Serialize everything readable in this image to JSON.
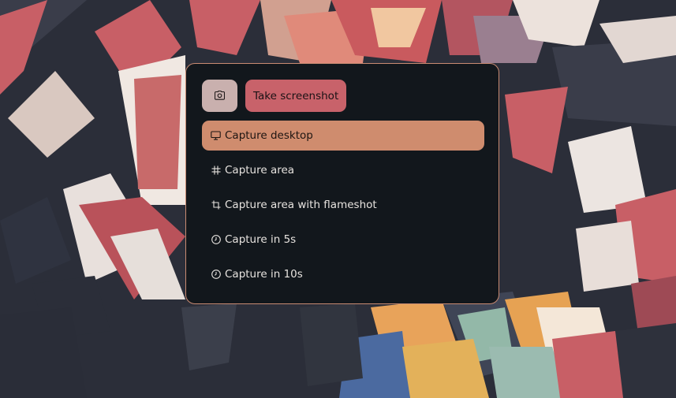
{
  "colors": {
    "panel_bg": "#12171c",
    "panel_border": "#c98b72",
    "camera_button_bg": "#c9b0ae",
    "primary_button_bg": "#c8626a",
    "active_item_bg": "#cf8c6e",
    "text": "#e7e3df"
  },
  "header": {
    "camera_icon": "camera-icon",
    "take_screenshot_label": "Take screenshot"
  },
  "menu": {
    "items": [
      {
        "label": "Capture desktop",
        "icon": "monitor-icon",
        "active": true
      },
      {
        "label": "Capture area",
        "icon": "hash-icon",
        "active": false
      },
      {
        "label": "Capture area with flameshot",
        "icon": "crop-icon",
        "active": false
      },
      {
        "label": "Capture in 5s",
        "icon": "clock-icon",
        "active": false
      },
      {
        "label": "Capture in 10s",
        "icon": "clock-icon",
        "active": false
      }
    ]
  }
}
